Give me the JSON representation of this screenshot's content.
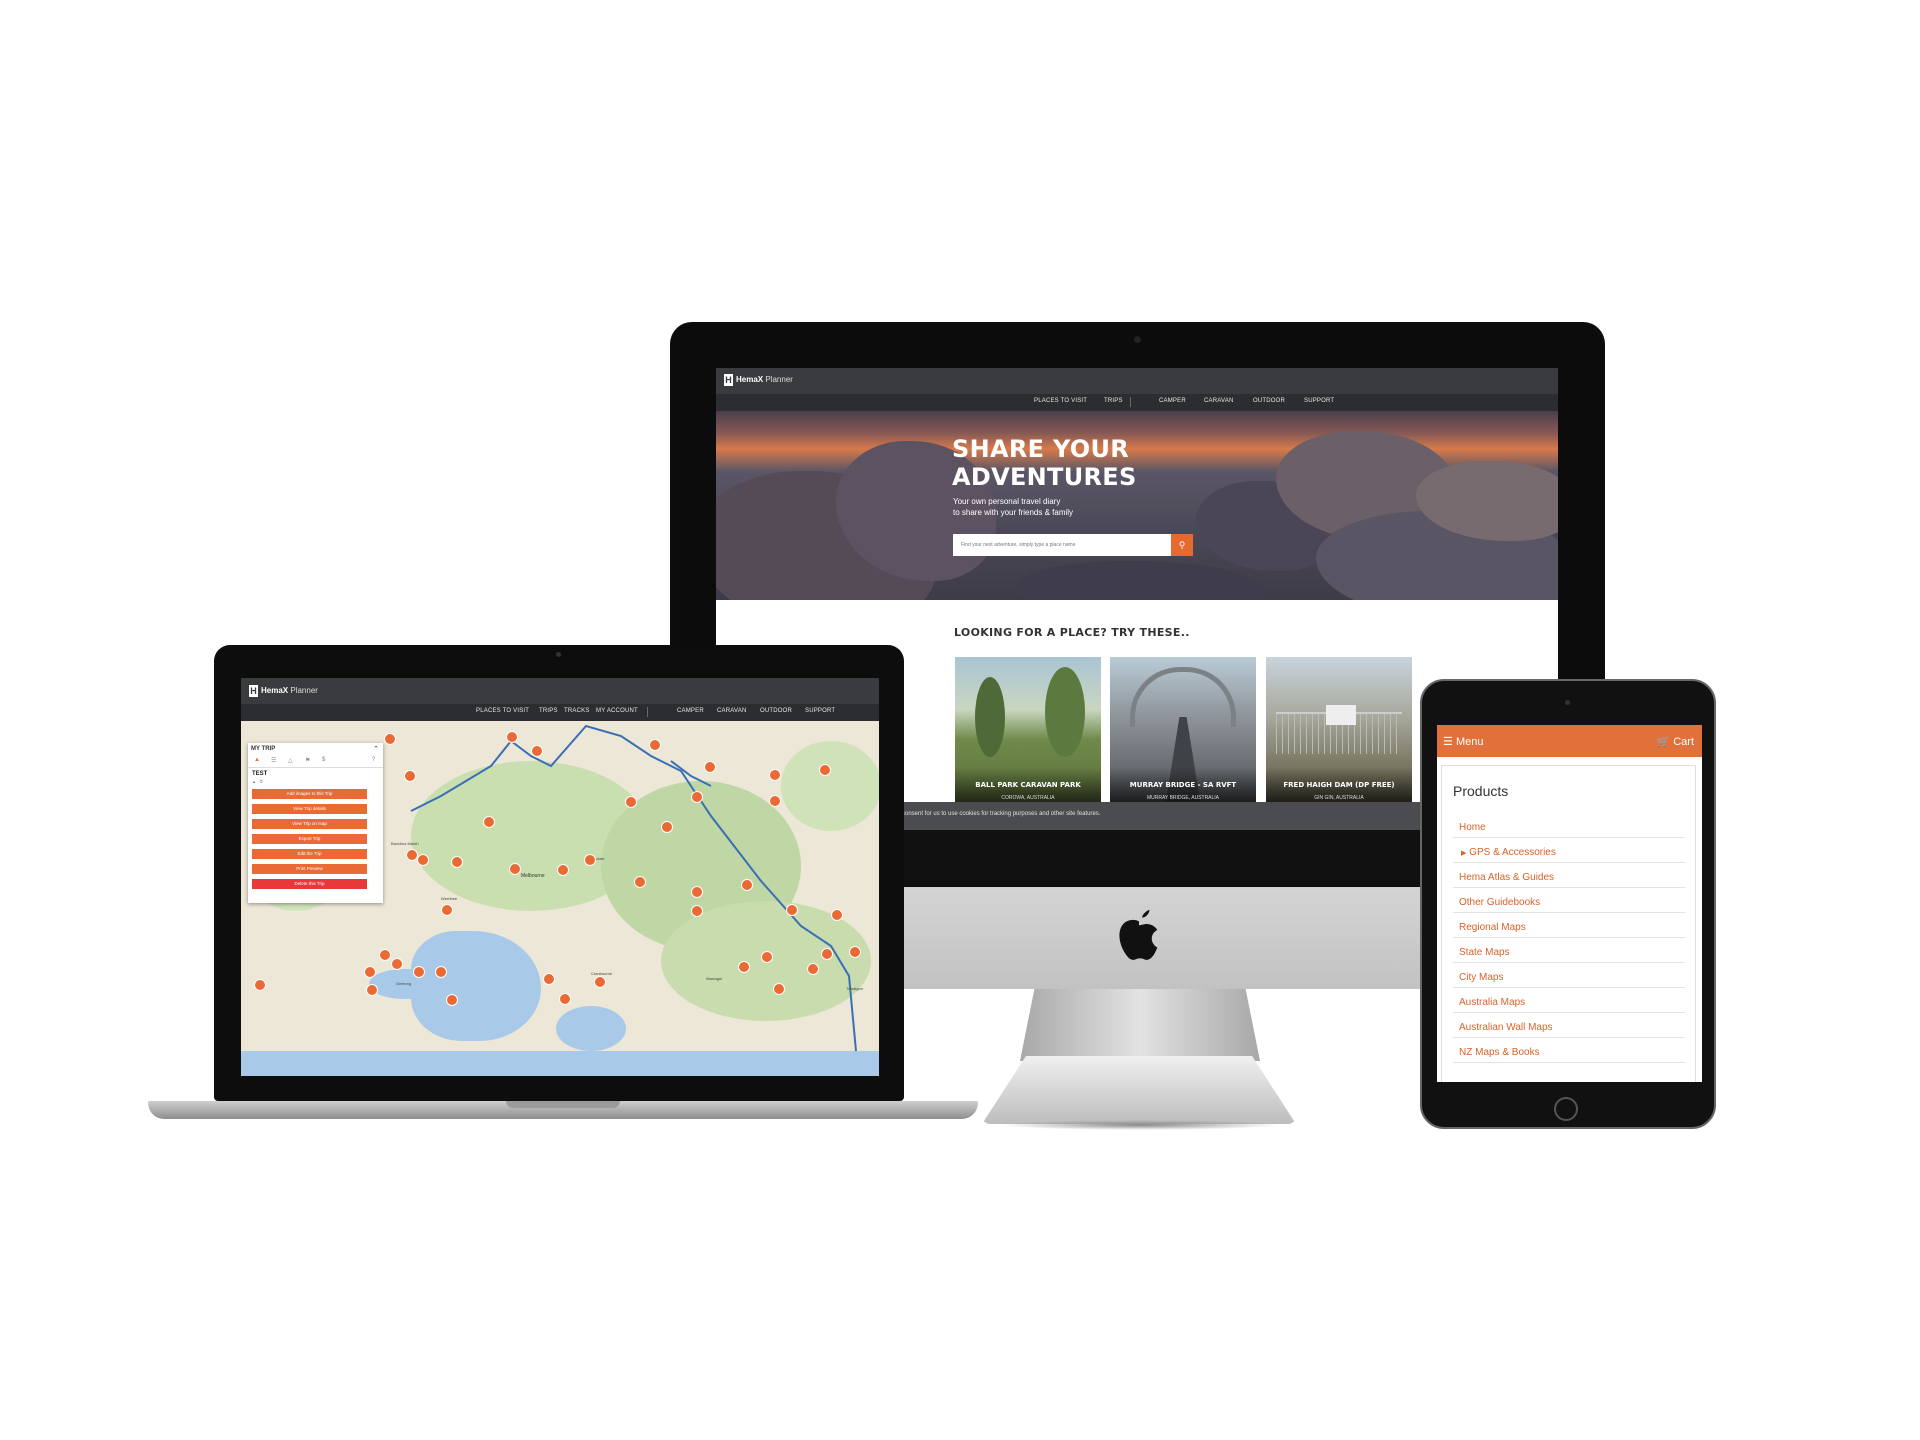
{
  "imac": {
    "brand_name": "HemaX",
    "brand_sub": "Planner",
    "nav": [
      "PLACES TO VISIT",
      "TRIPS",
      "CAMPER",
      "CARAVAN",
      "OUTDOOR",
      "SUPPORT"
    ],
    "hero_title_1": "SHARE YOUR",
    "hero_title_2": "ADVENTURES",
    "hero_sub_1": "Your own personal travel diary",
    "hero_sub_2": "to share with your friends & family",
    "search_placeholder": "Find your next adventure, simply type a place name",
    "section_title": "LOOKING FOR A PLACE? TRY THESE..",
    "cards": [
      {
        "name": "BALL PARK CARAVAN PARK",
        "location": "COROWA, AUSTRALIA"
      },
      {
        "name": "MURRAY BRIDGE - SA RVFT",
        "location": "MURRAY BRIDGE, AUSTRALIA"
      },
      {
        "name": "FRED HAIGH DAM (DP FREE)",
        "location": "GIN GIN, AUSTRALIA"
      }
    ],
    "cookie_text": "consent for us to use cookies for tracking purposes and other site features."
  },
  "laptop": {
    "brand_name": "HemaX",
    "brand_sub": "Planner",
    "nav": [
      "PLACES TO VISIT",
      "TRIPS",
      "TRACKS",
      "MY ACCOUNT",
      "CAMPER",
      "CARAVAN",
      "OUTDOOR",
      "SUPPORT"
    ],
    "panel_title": "MY TRIP",
    "trip_name": "TEST",
    "trip_buttons": [
      "Add images to this Trip",
      "View Trip details",
      "View Trip on map",
      "Export Trip",
      "Edit the Trip",
      "Print Preview",
      "Delete this Trip"
    ],
    "map_labels": [
      "Melbourne",
      "Lilydale",
      "Werribee",
      "Bacchus Marsh",
      "Cranbourne",
      "Warragul",
      "Traralgon",
      "Geelong"
    ]
  },
  "tablet": {
    "menu_label": "Menu",
    "cart_label": "Cart",
    "heading": "Products",
    "items": [
      "Home",
      "GPS & Accessories",
      "Hema Atlas & Guides",
      "Other Guidebooks",
      "Regional Maps",
      "State Maps",
      "City Maps",
      "Australia Maps",
      "Australian Wall Maps",
      "NZ Maps & Books"
    ]
  },
  "colors": {
    "accent": "#e8692e",
    "nav_dark": "#3a3b3e",
    "delete_red": "#e8393a"
  }
}
